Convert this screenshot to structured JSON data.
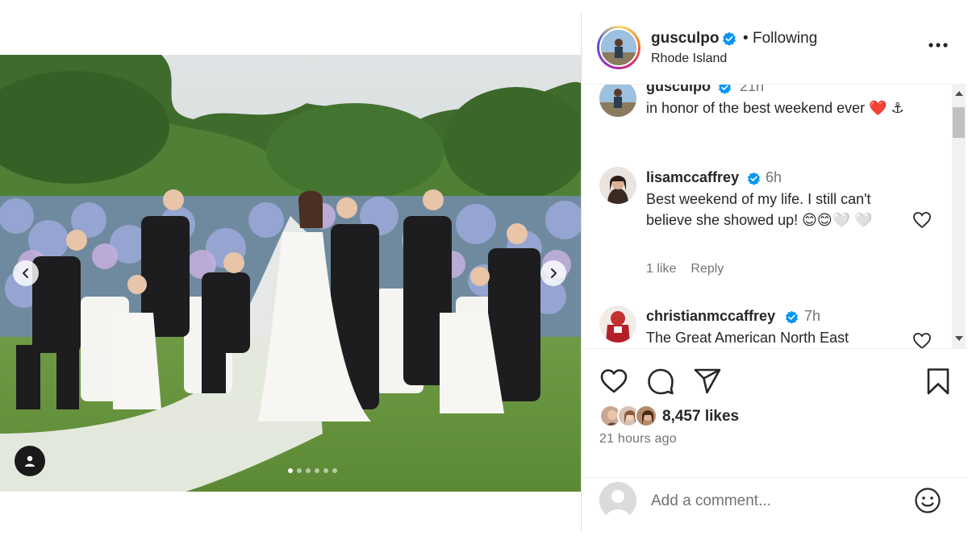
{
  "post": {
    "username": "gusculpo",
    "follow_status": "Following",
    "separator": "•",
    "location": "Rhode Island",
    "likes": "8,457 likes",
    "time_ago": "21 hours ago",
    "media_slide_count": 6,
    "media_active_slide": 1
  },
  "comments": [
    {
      "username": "gusculpo",
      "time": "21h",
      "text": "in honor of the best weekend ever ❤️ ⚓",
      "likes": "",
      "reply": ""
    },
    {
      "username": "lisamccaffrey",
      "time": "6h",
      "text": "Best weekend of my life. I still can't believe she showed up! 😊😊🤍 🤍",
      "likes": "1 like",
      "reply": "Reply"
    },
    {
      "username": "christianmccaffrey",
      "time": "7h",
      "text": "The Great American North East",
      "likes": "",
      "reply": ""
    }
  ],
  "comment_box": {
    "placeholder": "Add a comment..."
  },
  "icons": {
    "verified": "verified-badge-icon",
    "more": "more-options-icon",
    "like": "heart-icon",
    "comment": "comment-bubble-icon",
    "share": "paper-plane-icon",
    "save": "bookmark-icon",
    "emoji": "smiley-icon",
    "tag": "person-tag-icon"
  },
  "colors": {
    "verified_blue": "#0095f6",
    "text_primary": "#262626",
    "text_secondary": "#737373",
    "border": "#dbdbdb"
  }
}
